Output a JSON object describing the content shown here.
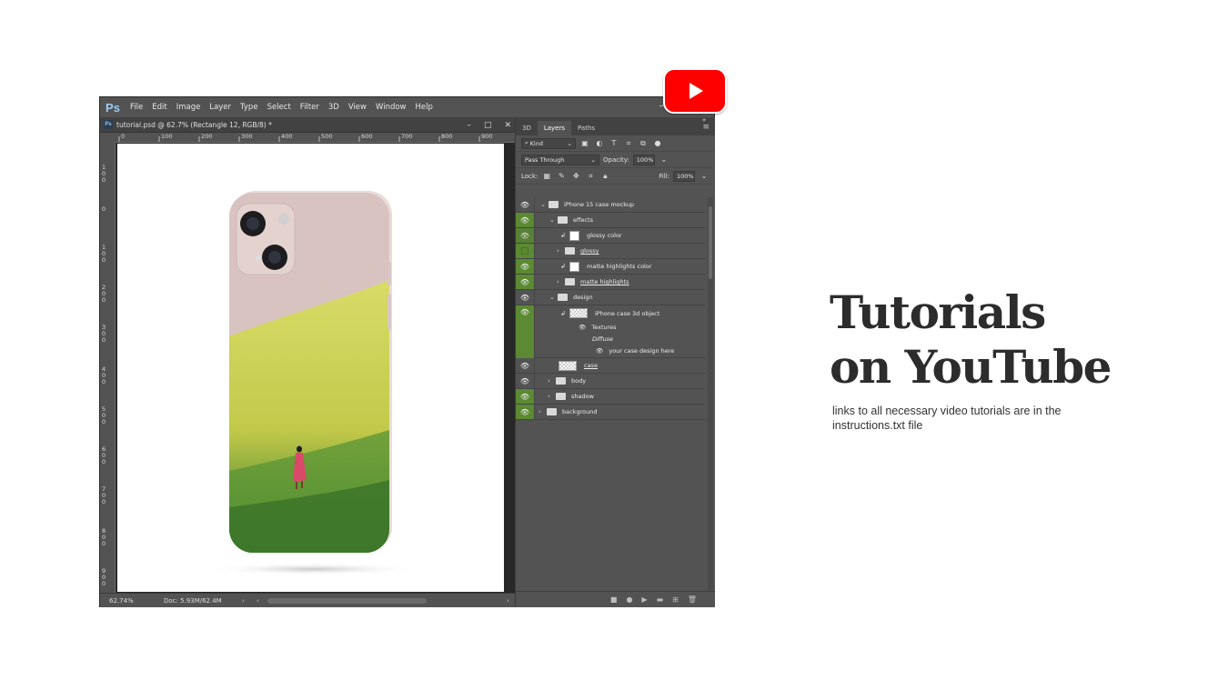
{
  "app": {
    "logo": "Ps"
  },
  "menu": [
    "File",
    "Edit",
    "Image",
    "Layer",
    "Type",
    "Select",
    "Filter",
    "3D",
    "View",
    "Window",
    "Help"
  ],
  "document": {
    "tab_title": "tutorial.psd @ 62.7% (Rectangle 12, RGB/8) *"
  },
  "rulers": {
    "h": [
      "0",
      "100",
      "200",
      "300",
      "400",
      "500",
      "600",
      "700",
      "800",
      "900"
    ],
    "v": [
      "100",
      "0",
      "100",
      "200",
      "300",
      "400",
      "500",
      "600",
      "700",
      "800",
      "900"
    ]
  },
  "status": {
    "zoom": "62.74%",
    "doc": "Doc: 5.93M/62.4M"
  },
  "panel": {
    "tabs": [
      "3D",
      "Layers",
      "Paths"
    ],
    "filter_kind": "Kind",
    "blend_mode": "Pass Through",
    "opacity_label": "Opacity:",
    "opacity_value": "100%",
    "lock_label": "Lock:",
    "fill_label": "Fill:",
    "fill_value": "100%"
  },
  "layers": [
    {
      "name": "iPhone 15 case mockup",
      "level": 0,
      "type": "group",
      "open": true,
      "eye": "normal"
    },
    {
      "name": "effects",
      "level": 1,
      "type": "group",
      "open": true,
      "eye": "green"
    },
    {
      "name": "glossy color",
      "level": 2,
      "type": "fill",
      "eye": "green"
    },
    {
      "name": "glossy",
      "level": 2,
      "type": "group",
      "open": false,
      "eye": "green-off",
      "underline": true
    },
    {
      "name": "matte highlights color",
      "level": 2,
      "type": "fill",
      "eye": "green"
    },
    {
      "name": "matte highlights",
      "level": 2,
      "type": "group",
      "open": false,
      "eye": "green",
      "underline": true
    },
    {
      "name": "design",
      "level": 1,
      "type": "group",
      "open": true,
      "eye": "normal"
    },
    {
      "name": "iPhone case 3d object",
      "level": 2,
      "type": "smart",
      "eye": "green"
    },
    {
      "name": "Textures",
      "level": 3,
      "type": "sub",
      "eye": "green-cont"
    },
    {
      "name": "Diffuse",
      "level": 4,
      "type": "sub-italic",
      "eye": "green-cont"
    },
    {
      "name": "your case design here",
      "level": 5,
      "type": "sub-eye",
      "eye": "green-cont"
    },
    {
      "name": "case",
      "level": 1,
      "type": "smart",
      "eye": "normal",
      "underline": true
    },
    {
      "name": "body",
      "level": 1,
      "type": "group",
      "open": false,
      "eye": "normal"
    },
    {
      "name": "shadow",
      "level": 1,
      "type": "group",
      "open": false,
      "eye": "green"
    },
    {
      "name": "background",
      "level": 0,
      "type": "group",
      "open": false,
      "eye": "green"
    }
  ],
  "promo": {
    "title_line1": "Tutorials",
    "title_line2": "on YouTube",
    "subtitle": "links to all necessary video tutorials are in the instructions.txt file"
  },
  "colors": {
    "youtube_red": "#ff0000",
    "ps_bg": "#535353",
    "eye_green": "#5b8a32",
    "title": "#2c2c2c"
  }
}
